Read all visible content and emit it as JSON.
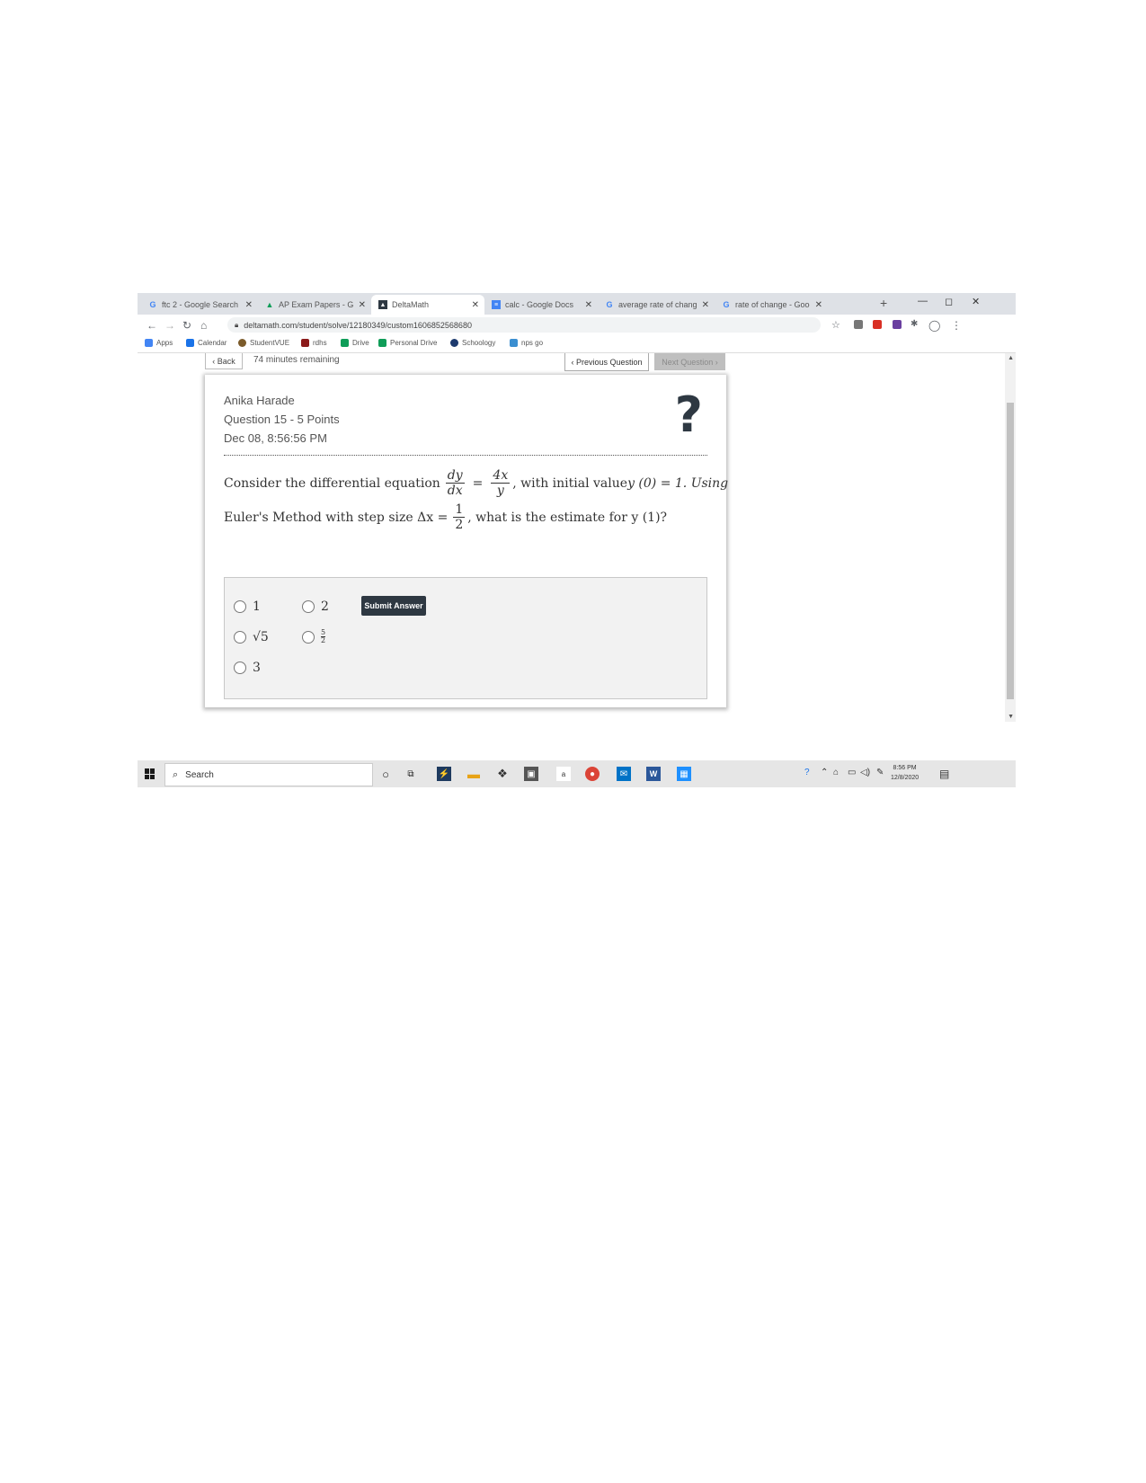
{
  "browser": {
    "tabs": [
      {
        "icon": "G",
        "label": "ftc 2 - Google Search"
      },
      {
        "icon": "drive",
        "label": "AP Exam Papers - Goog"
      },
      {
        "icon": "delta",
        "label": "DeltaMath"
      },
      {
        "icon": "docs",
        "label": "calc - Google Docs"
      },
      {
        "icon": "G",
        "label": "average rate of change"
      },
      {
        "icon": "G",
        "label": "rate of change - Googl"
      }
    ],
    "new_tab": "+",
    "minimize": "—",
    "restore": "◻",
    "close": "✕",
    "url": "deltamath.com/student/solve/12180349/custom1606852568680",
    "bookmarks": [
      {
        "label": "Apps",
        "color": "#4285f4"
      },
      {
        "label": "Calendar",
        "color": "#1a73e8"
      },
      {
        "label": "StudentVUE",
        "color": "#7b5b2a"
      },
      {
        "label": "rdhs",
        "color": "#8b1a1a"
      },
      {
        "label": "Drive",
        "color": "#0f9d58"
      },
      {
        "label": "Personal Drive",
        "color": "#0f9d58"
      },
      {
        "label": "Schoology",
        "color": "#1d3a6e"
      },
      {
        "label": "nps go",
        "color": "#3b8fd1"
      }
    ]
  },
  "page": {
    "back_label": "Back",
    "remaining": "74 minutes remaining",
    "prev_label": "Previous Question",
    "next_label": "Next Question",
    "student_name": "Anika Harade",
    "question_info": "Question 15 - 5 Points",
    "datetime": "Dec 08, 8:56:56 PM",
    "help_symbol": "?",
    "question": {
      "prefix": "Consider the differential equation",
      "deriv_num": "dy",
      "deriv_den": "dx",
      "equals": "=",
      "rhs_num": "4x",
      "rhs_den": "y",
      "middle": ", with initial value ",
      "initial": "y (0) = 1. Using",
      "line2_prefix": "Euler's Method with step size Δx =",
      "step_num": "1",
      "step_den": "2",
      "line2_suffix": ", what is the estimate for y (1)?"
    },
    "options": [
      {
        "label": "1"
      },
      {
        "label": "2"
      },
      {
        "label": "√5"
      },
      {
        "num": "5",
        "den": "2"
      },
      {
        "label": "3"
      }
    ],
    "submit_label": "Submit Answer"
  },
  "taskbar": {
    "search_label": "Search",
    "time": "8:56 PM",
    "date": "12/8/2020"
  }
}
